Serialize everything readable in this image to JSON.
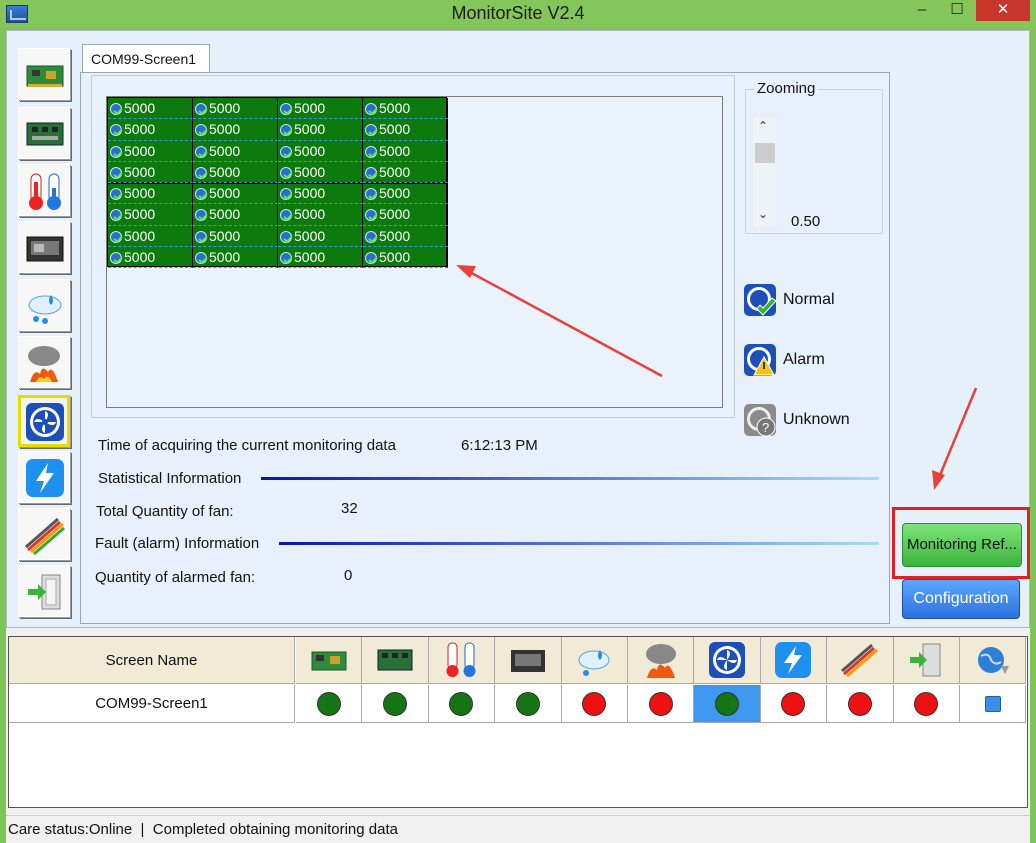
{
  "window": {
    "title": "MonitorSite V2.4",
    "min_label": "–",
    "max_label": "☐",
    "close_label": "✕"
  },
  "sidebar": {
    "items": [
      {
        "icon": "receiving-card-icon"
      },
      {
        "icon": "module-board-icon"
      },
      {
        "icon": "thermometer-icon"
      },
      {
        "icon": "controller-card-icon"
      },
      {
        "icon": "humidity-icon"
      },
      {
        "icon": "smoke-fire-icon"
      },
      {
        "icon": "fan-icon",
        "selected": true
      },
      {
        "icon": "power-icon"
      },
      {
        "icon": "cable-icon"
      },
      {
        "icon": "exit-icon"
      }
    ]
  },
  "tab": {
    "label": "COM99-Screen1"
  },
  "fan_grid": {
    "cell_value": "5000",
    "rows": 8,
    "cols": 4
  },
  "zoom": {
    "label": "Zooming",
    "value": "0.50"
  },
  "legend": {
    "normal": "Normal",
    "alarm": "Alarm",
    "unknown": "Unknown"
  },
  "info": {
    "time_label": "Time of acquiring the current monitoring data",
    "time_value": "6:12:13 PM",
    "statistical_label": "Statistical Information",
    "total_fan_label": "Total Quantity of fan:",
    "total_fan_value": "32",
    "fault_label": "Fault (alarm) Information",
    "alarmed_fan_label": "Quantity of alarmed fan:",
    "alarmed_fan_value": "0"
  },
  "buttons": {
    "refresh": "Monitoring Ref...",
    "configuration": "Configuration"
  },
  "table": {
    "name_header": "Screen Name",
    "columns": [
      "receiving-card-icon",
      "module-board-icon",
      "thermometer-icon",
      "controller-card-icon",
      "humidity-icon",
      "smoke-fire-icon",
      "fan-icon",
      "power-icon",
      "cable-icon",
      "exit-icon",
      "globe-refresh-icon"
    ],
    "row": {
      "name": "COM99-Screen1",
      "statuses": [
        "green",
        "green",
        "green",
        "green",
        "red",
        "red",
        "green",
        "red",
        "red",
        "red",
        "checkbox"
      ],
      "selected_index": 6
    },
    "colors": {
      "green": "#157515",
      "red": "#ee1111",
      "selected": "#3f98f0"
    }
  },
  "status": {
    "text": "Care status:Online  |  Completed obtaining monitoring data"
  }
}
